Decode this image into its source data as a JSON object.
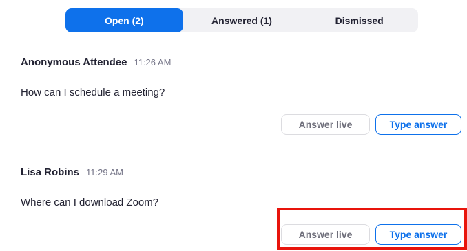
{
  "tabs": [
    {
      "label": "Open (2)",
      "active": true
    },
    {
      "label": "Answered (1)",
      "active": false
    },
    {
      "label": "Dismissed",
      "active": false
    }
  ],
  "questions": [
    {
      "author": "Anonymous Attendee",
      "time": "11:26 AM",
      "text": "How can I schedule a meeting?",
      "answer_live_label": "Answer live",
      "type_answer_label": "Type answer"
    },
    {
      "author": "Lisa Robins",
      "time": "11:29 AM",
      "text": "Where can I download Zoom?",
      "answer_live_label": "Answer live",
      "type_answer_label": "Type answer"
    }
  ],
  "colors": {
    "accent": "#0e71eb",
    "highlight": "#e8140c",
    "tab_track": "#f1f1f4",
    "text": "#232333",
    "muted": "#747487"
  }
}
